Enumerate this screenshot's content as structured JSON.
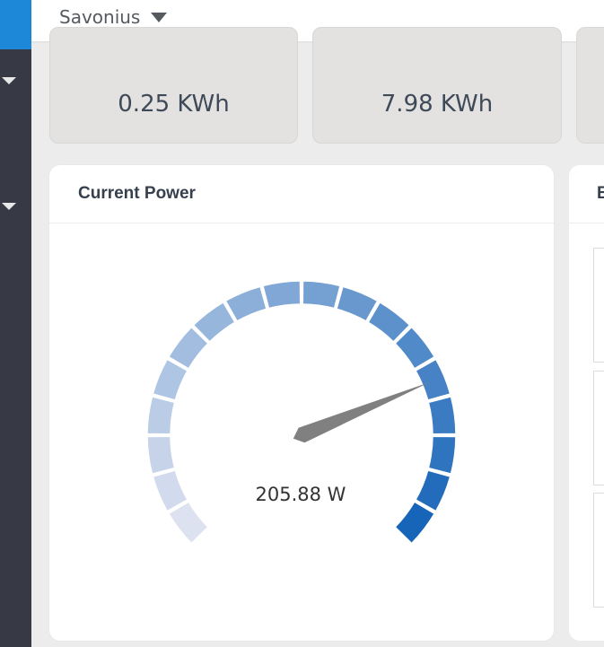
{
  "header": {
    "title": "Savonius"
  },
  "stats": [
    {
      "value": "0.25 KWh"
    },
    {
      "value": "7.98 KWh"
    }
  ],
  "panel": {
    "title": "Current Power",
    "reading": "205.88 W",
    "gauge_level": 0.75
  },
  "right_panel": {
    "title_fragment": "E"
  },
  "colors": {
    "accent": "#1e88d8",
    "sidebar": "#373a45",
    "gauge_low": "#dde2f0",
    "gauge_high": "#1765b8",
    "needle": "#808080"
  }
}
